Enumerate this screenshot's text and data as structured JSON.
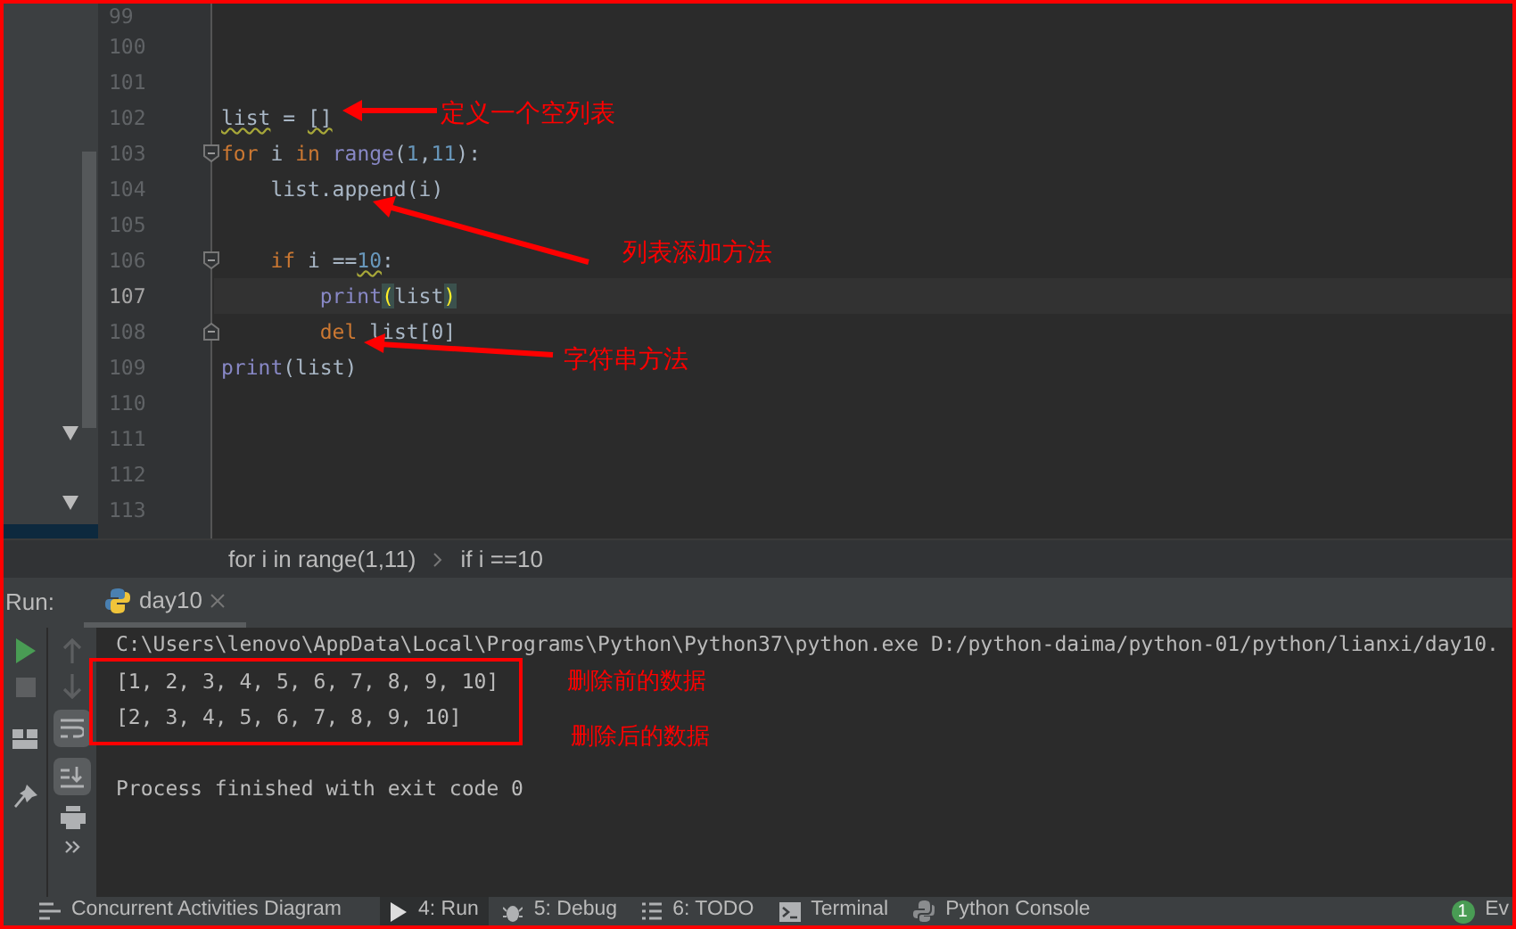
{
  "editor": {
    "lines": [
      {
        "number": "99",
        "current": false
      },
      {
        "number": "100",
        "current": false
      },
      {
        "number": "101",
        "current": false
      },
      {
        "number": "102",
        "current": false,
        "tokens": [
          {
            "text": "list",
            "kind": "plain",
            "warning": true
          },
          {
            "text": " = ",
            "kind": "plain"
          },
          {
            "text": "[]",
            "kind": "plain",
            "warning": true
          }
        ]
      },
      {
        "number": "103",
        "current": false,
        "fold_start": true,
        "tokens": [
          {
            "text": "for",
            "kind": "keyword"
          },
          {
            "text": " i ",
            "kind": "plain"
          },
          {
            "text": "in",
            "kind": "keyword"
          },
          {
            "text": " range",
            "kind": "builtin"
          },
          {
            "text": "(",
            "kind": "plain"
          },
          {
            "text": "1",
            "kind": "number"
          },
          {
            "text": ",",
            "kind": "plain"
          },
          {
            "text": "11",
            "kind": "number"
          },
          {
            "text": "):",
            "kind": "plain"
          }
        ]
      },
      {
        "number": "104",
        "current": false,
        "tokens": [
          {
            "text": "    list.append(i)",
            "kind": "plain"
          }
        ]
      },
      {
        "number": "105",
        "current": false
      },
      {
        "number": "106",
        "current": false,
        "fold_start": true,
        "tokens": [
          {
            "text": "    if",
            "kind": "keyword"
          },
          {
            "text": " i ==",
            "kind": "plain"
          },
          {
            "text": "10",
            "kind": "number",
            "warning": true
          },
          {
            "text": ":",
            "kind": "plain"
          }
        ]
      },
      {
        "number": "107",
        "current": true,
        "tokens": [
          {
            "text": "        print",
            "kind": "builtin"
          },
          {
            "text": "(",
            "kind": "match"
          },
          {
            "text": "list",
            "kind": "plain"
          },
          {
            "text": ")",
            "kind": "match"
          }
        ]
      },
      {
        "number": "108",
        "current": false,
        "fold_end": true,
        "tokens": [
          {
            "text": "        del",
            "kind": "keyword"
          },
          {
            "text": " list[0]",
            "kind": "plain"
          }
        ]
      },
      {
        "number": "109",
        "current": false,
        "tokens": [
          {
            "text": "print",
            "kind": "builtin"
          },
          {
            "text": "(list)",
            "kind": "plain"
          }
        ]
      },
      {
        "number": "110",
        "current": false
      },
      {
        "number": "111",
        "current": false
      },
      {
        "number": "112",
        "current": false
      },
      {
        "number": "113",
        "current": false
      }
    ]
  },
  "breadcrumbs": [
    "for i in range(1,11)",
    "if i ==10"
  ],
  "run_panel": {
    "label": "Run:",
    "tabs": [
      {
        "label": "day10",
        "selected": true
      }
    ]
  },
  "console": {
    "command": "C:\\Users\\lenovo\\AppData\\Local\\Programs\\Python\\Python37\\python.exe D:/python-daima/python-01/python/lianxi/day10.",
    "output": [
      "[1, 2, 3, 4, 5, 6, 7, 8, 9, 10]",
      "[2, 3, 4, 5, 6, 7, 8, 9, 10]"
    ],
    "exit": "Process finished with exit code 0"
  },
  "annotations": [
    "定义一个空列表",
    "列表添加方法",
    "字符串方法",
    "删除前的数据",
    "删除后的数据"
  ],
  "tool_windows": [
    {
      "label": "Concurrent Activities Diagram",
      "kind": "diagram",
      "selected": false
    },
    {
      "label": "4: Run",
      "kind": "run",
      "selected": true
    },
    {
      "label": "5: Debug",
      "kind": "debug",
      "selected": false
    },
    {
      "label": "6: TODO",
      "kind": "todo",
      "selected": false
    },
    {
      "label": "Terminal",
      "kind": "terminal",
      "selected": false
    },
    {
      "label": "Python Console",
      "kind": "python",
      "selected": false
    },
    {
      "label": "Ev",
      "kind": "events",
      "badge": "1",
      "selected": false
    }
  ]
}
